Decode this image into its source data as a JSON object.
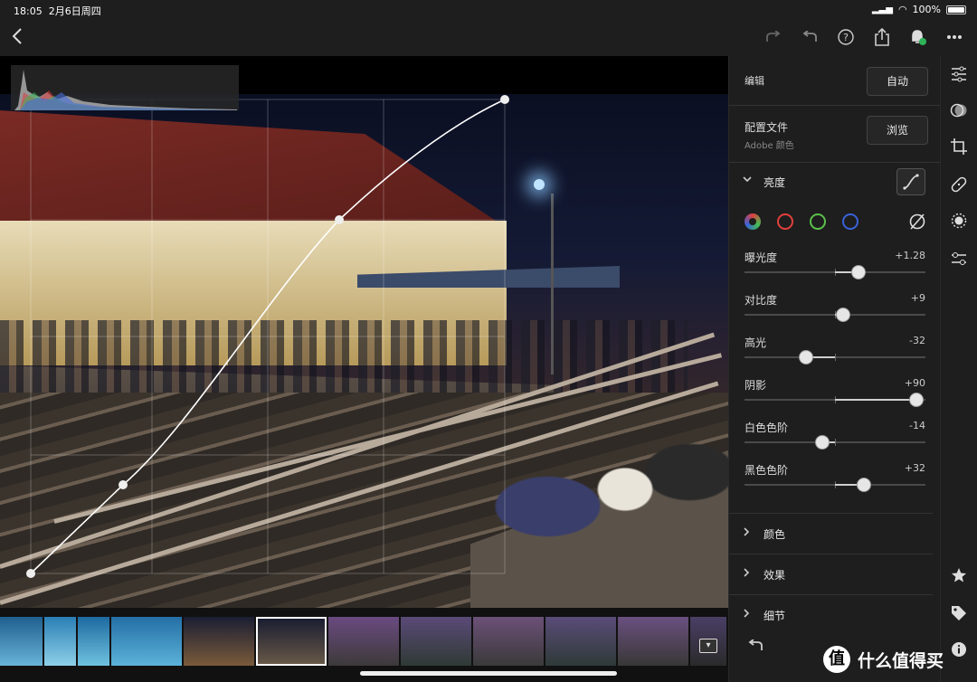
{
  "status_bar": {
    "time": "18:05",
    "date": "2月6日周四",
    "battery": "100%"
  },
  "top_bar": {
    "back_icon": "chevron-left-icon",
    "icons": [
      "redo-icon",
      "undo-icon",
      "help-icon",
      "share-icon",
      "notification-icon",
      "more-icon"
    ]
  },
  "panel": {
    "edit_label": "编辑",
    "auto_button": "自动",
    "profile_label": "配置文件",
    "profile_value": "Adobe 颜色",
    "browse_button": "浏览",
    "light_section": "亮度",
    "channels": [
      {
        "name": "composite",
        "color": "#8a8a8a"
      },
      {
        "name": "red",
        "color": "#e0403c"
      },
      {
        "name": "green",
        "color": "#5ac04a"
      },
      {
        "name": "blue",
        "color": "#3a62d8"
      }
    ],
    "sliders": [
      {
        "name": "曝光度",
        "value": "+1.28",
        "level": 0.628
      },
      {
        "name": "对比度",
        "value": "+9",
        "level": 0.545
      },
      {
        "name": "高光",
        "value": "-32",
        "level": 0.34
      },
      {
        "name": "阴影",
        "value": "+90",
        "level": 0.95
      },
      {
        "name": "白色色阶",
        "value": "-14",
        "level": 0.43
      },
      {
        "name": "黑色色阶",
        "value": "+32",
        "level": 0.66
      }
    ],
    "collapsed_sections": [
      "颜色",
      "效果",
      "细节"
    ]
  },
  "tools": [
    "adjust-icon",
    "presets-icon",
    "crop-icon",
    "heal-icon",
    "mask-icon",
    "versions-icon",
    "star-icon",
    "tag-icon",
    "info-icon"
  ],
  "filmstrip": {
    "thumbs": [
      {
        "colors": [
          "#1f5f8f",
          "#69b3d8"
        ],
        "width": 47
      },
      {
        "colors": [
          "#2a7fb5",
          "#8ed0e8"
        ],
        "width": 35
      },
      {
        "colors": [
          "#1d6aa0",
          "#6fc2e0"
        ],
        "width": 35
      },
      {
        "colors": [
          "#246fa6",
          "#5bb2d8"
        ],
        "width": 78
      },
      {
        "colors": [
          "#1a1e33",
          "#7a5a3a"
        ],
        "width": 78
      },
      {
        "colors": [
          "#171b30",
          "#6a5a48"
        ],
        "width": 78,
        "selected": true
      },
      {
        "colors": [
          "#6a4a80",
          "#3d3a3a"
        ],
        "width": 78
      },
      {
        "colors": [
          "#5b4a78",
          "#2f3a35"
        ],
        "width": 78
      },
      {
        "colors": [
          "#6c5078",
          "#3a3a3a"
        ],
        "width": 78
      },
      {
        "colors": [
          "#5a4c78",
          "#2e3a38"
        ],
        "width": 78
      },
      {
        "colors": [
          "#6a5080",
          "#383836"
        ],
        "width": 78
      },
      {
        "colors": [
          "#4a3f66",
          "#2a2a2a"
        ],
        "width": 40
      }
    ],
    "filter_icon": "filter-icon"
  },
  "watermark": {
    "text": "什么值得买",
    "logo_glyph": "值"
  }
}
